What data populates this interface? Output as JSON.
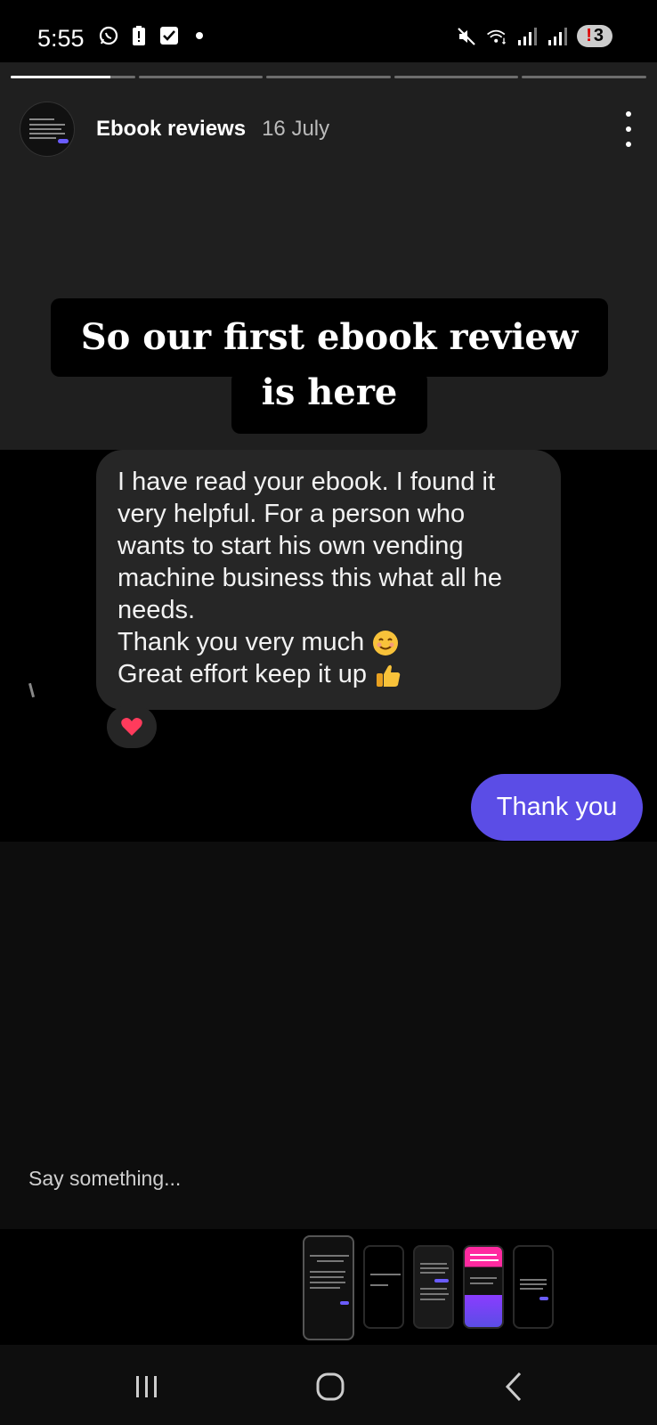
{
  "status_bar": {
    "time": "5:55",
    "notification_count": "3",
    "icons_left": [
      "whatsapp-icon",
      "battery-alert-icon",
      "checkbox-icon",
      "dot-icon"
    ],
    "icons_right": [
      "mute-icon",
      "wifi-icon",
      "signal-icon",
      "signal-icon",
      "notification-badge"
    ]
  },
  "story": {
    "progress_segments": 5,
    "active_segment": 1,
    "account_name": "Ebook reviews",
    "date": "16 July",
    "caption_line1": "So our first ebook review",
    "caption_line2": "is here",
    "message_lines": [
      "I have read your ebook. I found it",
      "very helpful. For a person who",
      "wants to start his own vending",
      "machine business this what all he",
      "needs.",
      "Thank you very much",
      "Great effort keep it up"
    ],
    "reaction": "heart-icon",
    "reply": "Thank you"
  },
  "input": {
    "placeholder": "Say something..."
  },
  "colors": {
    "accent_purple": "#5b4de6",
    "bubble_gray": "#262626",
    "story_bg": "#1f1f1f"
  }
}
